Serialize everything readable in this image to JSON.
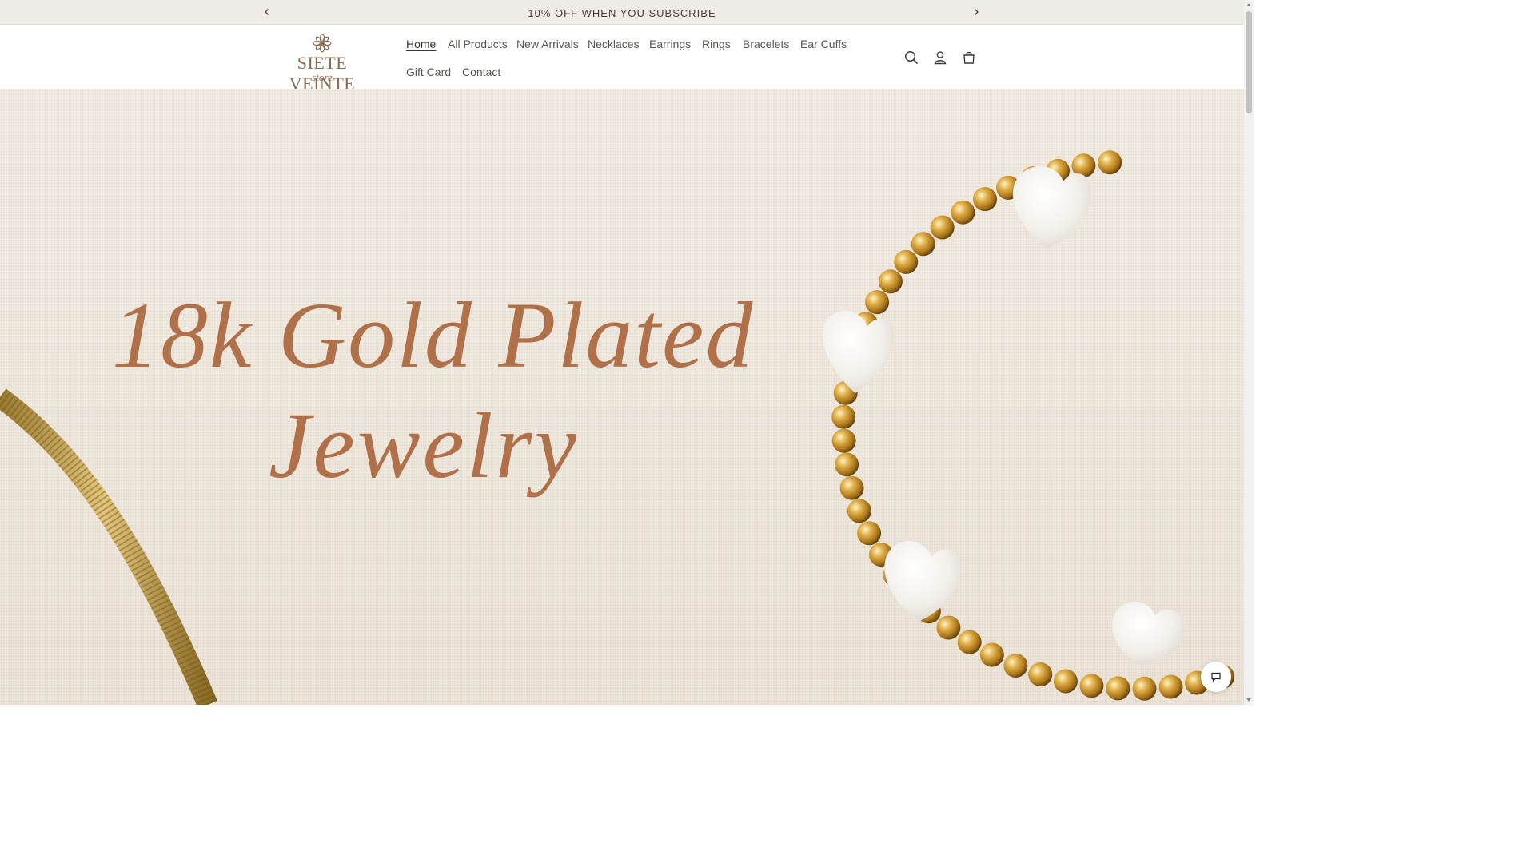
{
  "announcement": {
    "text": "10% OFF WHEN YOU SUBSCRIBE",
    "prev_icon": "chevron-left-icon",
    "next_icon": "chevron-right-icon"
  },
  "logo": {
    "brand": "SIETE VEINTE",
    "sub": "store",
    "icon": "flower-icon"
  },
  "nav": {
    "items": [
      {
        "label": "Home",
        "active": true
      },
      {
        "label": "All Products"
      },
      {
        "label": "New Arrivals"
      },
      {
        "label": "Necklaces"
      },
      {
        "label": "Earrings"
      },
      {
        "label": "Rings"
      },
      {
        "label": "Bracelets"
      },
      {
        "label": "Ear Cuffs"
      },
      {
        "label": "Gift Card"
      },
      {
        "label": "Contact"
      }
    ]
  },
  "header_icons": [
    "search-icon",
    "account-icon",
    "cart-icon"
  ],
  "hero": {
    "line1": "18k Gold Plated",
    "line2": "Jewelry"
  },
  "chat": {
    "icon": "chat-icon"
  },
  "colors": {
    "announcement_bg": "#efebe6",
    "hero_text": "#b0714a",
    "gold": "#c9962e",
    "pearl": "#f5f2ee"
  }
}
